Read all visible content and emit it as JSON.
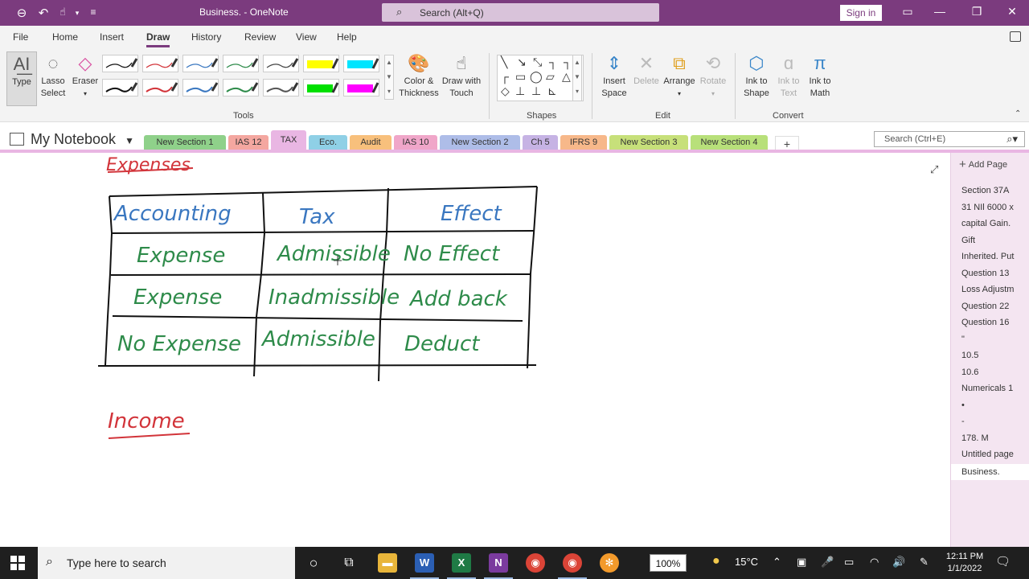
{
  "titlebar": {
    "doc_title": "Business.  -  OneNote",
    "search_placeholder": "Search (Alt+Q)",
    "signin_label": "Sign in",
    "back_icon": "back-arrow-icon",
    "undo_icon": "undo-icon",
    "touch_icon": "touch-mode-icon"
  },
  "menu": {
    "tabs": [
      "File",
      "Home",
      "Insert",
      "Draw",
      "History",
      "Review",
      "View",
      "Help"
    ],
    "active": "Draw"
  },
  "ribbon": {
    "type_label": "Type",
    "lasso_label_1": "Lasso",
    "lasso_label_2": "Select",
    "eraser_label": "Eraser",
    "color_label_1": "Color &",
    "color_label_2": "Thickness",
    "touch_label_1": "Draw with",
    "touch_label_2": "Touch",
    "insert_space_1": "Insert",
    "insert_space_2": "Space",
    "delete_label": "Delete",
    "arrange_label": "Arrange",
    "rotate_label": "Rotate",
    "ink_shape_1": "Ink to",
    "ink_shape_2": "Shape",
    "ink_text_1": "Ink to",
    "ink_text_2": "Text",
    "ink_math_1": "Ink to",
    "ink_math_2": "Math",
    "groups": {
      "tools": "Tools",
      "shapes": "Shapes",
      "edit": "Edit",
      "convert": "Convert"
    },
    "pen_colors": [
      "#111111",
      "#d2343a",
      "#3a77c0",
      "#2e8b4a",
      "#444444",
      "#ffff00",
      "#00e5ff",
      "#111111",
      "#d2343a",
      "#3a77c0",
      "#2e8b4a",
      "#555555",
      "#00e000",
      "#ff00ff"
    ]
  },
  "notebook": {
    "name": "My Notebook",
    "search_placeholder": "Search (Ctrl+E)",
    "sections": [
      {
        "label": "New Section 1",
        "color": "#8fd18a"
      },
      {
        "label": "IAS 12",
        "color": "#f4a7a0"
      },
      {
        "label": "TAX",
        "color": "#e9b6e3"
      },
      {
        "label": "Eco.",
        "color": "#8fd0e6"
      },
      {
        "label": "Audit",
        "color": "#f8c07c"
      },
      {
        "label": "IAS 10",
        "color": "#f0a6c9"
      },
      {
        "label": "New Section 2",
        "color": "#aebde8"
      },
      {
        "label": "Ch 5",
        "color": "#c6b3e4"
      },
      {
        "label": "IFRS 9",
        "color": "#f7b88a"
      },
      {
        "label": "New Section 3",
        "color": "#c7e07a"
      },
      {
        "label": "New Section 4",
        "color": "#b8e07a"
      }
    ],
    "active_section": "TAX"
  },
  "page": {
    "heading_expenses": "Expenses",
    "heading_income": "Income",
    "table": {
      "headers": [
        "Accounting",
        "Tax",
        "Effect"
      ],
      "rows": [
        [
          "Expense",
          "Admissible",
          "No Effect"
        ],
        [
          "Expense",
          "Inadmissible",
          "Add back"
        ],
        [
          "No Expense",
          "Admissible",
          "Deduct"
        ]
      ]
    }
  },
  "pagelist": {
    "add_label": "Add Page",
    "pages": [
      "Section 37A",
      "31 NIl 6000 x",
      "capital Gain.",
      "Gift",
      "Inherited. Put",
      "Question 13",
      "Loss Adjustm",
      "Question 22",
      "Question 16",
      "\"",
      "10.5",
      "10.6",
      "Numericals 1",
      "•",
      "-",
      "178. M",
      "Untitled page",
      "Business."
    ],
    "active": "Business."
  },
  "taskbar": {
    "search_placeholder": "Type here to search",
    "zoom": "100%",
    "weather": "15°C",
    "time": "12:11 PM",
    "date": "1/1/2022"
  }
}
